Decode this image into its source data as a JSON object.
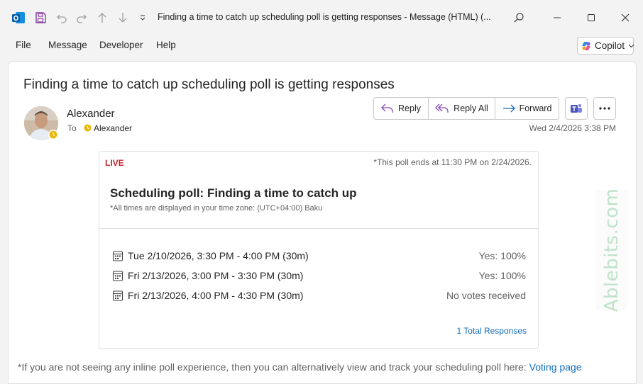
{
  "window": {
    "title": "Finding a time to catch up scheduling poll is getting responses  -  Message (HTML) (...",
    "controls": [
      "minimize-icon",
      "maximize-icon",
      "close-icon"
    ]
  },
  "quick_access": [
    "outlook-logo",
    "save-icon",
    "undo-icon",
    "redo-icon",
    "up-arrow-icon",
    "down-arrow-icon",
    "customize-chevron-icon"
  ],
  "menu": {
    "items": [
      "File",
      "Message",
      "Developer",
      "Help"
    ],
    "copilot_label": "Copilot"
  },
  "message": {
    "subject": "Finding a time to catch up scheduling poll is getting responses",
    "sender": "Alexander",
    "to_label": "To",
    "to_name": "Alexander",
    "date": "Wed 2/4/2026 3:38 PM",
    "actions": {
      "reply": "Reply",
      "reply_all": "Reply All",
      "forward": "Forward"
    }
  },
  "poll": {
    "status": "LIVE",
    "ends_note": "*This poll ends at 11:30 PM on 2/24/2026.",
    "title": "Scheduling poll: Finding a time to catch up",
    "timezone_note": "*All times are displayed in your time zone: (UTC+04:00) Baku",
    "slots": [
      {
        "time": "Tue 2/10/2026, 3:30 PM - 4:00 PM (30m)",
        "votes": "Yes: 100%"
      },
      {
        "time": "Fri 2/13/2026, 3:00 PM - 3:30 PM (30m)",
        "votes": "Yes: 100%"
      },
      {
        "time": "Fri 2/13/2026, 4:00 PM - 4:30 PM (30m)",
        "votes": "No votes received"
      }
    ],
    "total_responses": "1 Total Responses"
  },
  "footer": {
    "text": "*If you are not seeing any inline poll experience, then you can alternatively view and track your scheduling poll here:",
    "link": "Voting page"
  },
  "watermark": "Ablebits.com",
  "colors": {
    "accent_blue": "#0f6cbd",
    "live_red": "#c4262e",
    "reply_purple": "#8a4bb5",
    "forward_blue": "#0f6cbd",
    "presence_yellow": "#e8b80c"
  }
}
